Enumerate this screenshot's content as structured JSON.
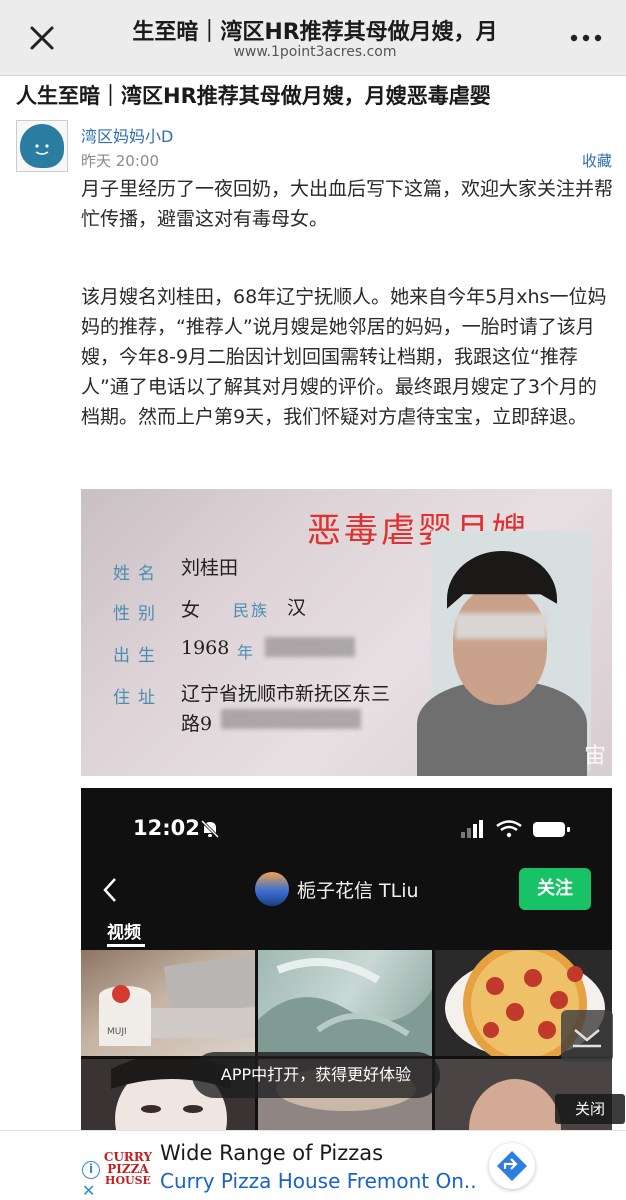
{
  "nav": {
    "title": "生至暗｜湾区HR推荐其母做月嫂，月",
    "url": "www.1point3acres.com",
    "close_icon": "close-icon",
    "more_icon": "more-icon"
  },
  "post": {
    "headline": "人生至暗｜湾区HR推荐其母做月嫂，月嫂恶毒虐婴",
    "author": "湾区妈妈小D",
    "time": "昨天 20:00",
    "favorite_label": "收藏",
    "paragraphs": [
      "月子里经历了一夜回奶，大出血后写下这篇，欢迎大家关注并帮忙传播，避雷这对有毒母女。",
      "该月嫂名刘桂田，68年辽宁抚顺人。她来自今年5月xhs一位妈妈的推荐，“推荐人”说月嫂是她邻居的妈妈，一胎时请了该月嫂，今年8-9月二胎因计划回国需转让档期，我跟这位“推荐人”通了电话以了解其对月嫂的评价。最终跟月嫂定了3个月的档期。然而上户第9天，我们怀疑对方虐待宝宝，立即辞退。"
    ]
  },
  "id_card": {
    "stamp": "恶毒虐婴月嫂",
    "name_label": "姓名",
    "name": "刘桂田",
    "gender_label": "性别",
    "gender": "女",
    "ethnicity_label": "民族",
    "ethnicity": "汉",
    "birth_label": "出生",
    "birth_year": "1968",
    "birth_year_unit": "年",
    "address_label": "住址",
    "address_line1": "辽宁省抚顺市新抚区东三",
    "address_line2": "路9",
    "watermark": "宙"
  },
  "phone_screenshot": {
    "time": "12:02",
    "account_name": "栀子花信 TLiu",
    "follow_label": "关注",
    "tab_label": "视频",
    "cup_text": "MUJI"
  },
  "overlay": {
    "open_app": "APP中打开，获得更好体验",
    "close_label": "关闭"
  },
  "ad": {
    "logo_lines": [
      "CURRY",
      "PIZZA",
      "HOUSE"
    ],
    "title": "Wide Range of Pizzas",
    "subtitle": "Curry Pizza House Fremont On...",
    "info_icon": "i",
    "close_x": "✕"
  },
  "colors": {
    "link_blue": "#2e6fb0",
    "stamp_red": "#e03030",
    "follow_green": "#18c266",
    "ad_blue": "#1a63c9"
  }
}
